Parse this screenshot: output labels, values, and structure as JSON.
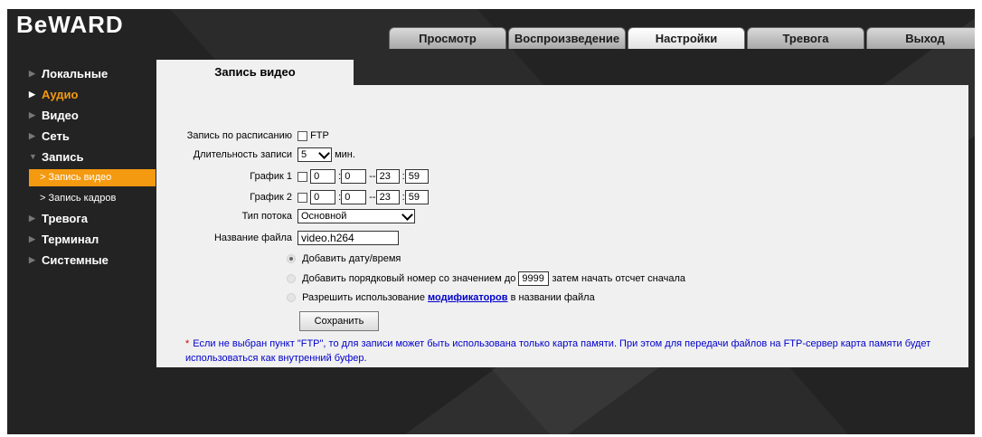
{
  "logo": "BeWARD",
  "tabs": [
    "Просмотр",
    "Воспроизведение",
    "Настройки",
    "Тревога",
    "Выход"
  ],
  "active_tab": "Настройки",
  "sidebar": {
    "items": [
      {
        "label": "Локальные"
      },
      {
        "label": "Аудио"
      },
      {
        "label": "Видео"
      },
      {
        "label": "Сеть"
      },
      {
        "label": "Запись"
      },
      {
        "label": "Тревога"
      },
      {
        "label": "Терминал"
      },
      {
        "label": "Системные"
      }
    ],
    "sub_items": [
      {
        "label": "Запись видео"
      },
      {
        "label": "Запись кадров"
      }
    ]
  },
  "panel": {
    "title": "Запись видео",
    "schedule_label": "Запись по расписанию",
    "ftp_label": "FTP",
    "duration_label": "Длительность записи",
    "duration_value": "5",
    "duration_unit": "мин.",
    "schedule1_label": "График 1",
    "schedule2_label": "График 2",
    "schedule1": {
      "h1": "0",
      "m1": "0",
      "h2": "23",
      "m2": "59"
    },
    "schedule2": {
      "h1": "0",
      "m1": "0",
      "h2": "23",
      "m2": "59"
    },
    "stream_label": "Тип потока",
    "stream_value": "Основной",
    "filename_label": "Название файла",
    "filename_value": "video.h264",
    "opt1": "Добавить дату/время",
    "opt2_pre": "Добавить порядковый номер со значением до",
    "opt2_value": "9999",
    "opt2_post": "затем начать отсчет сначала",
    "opt3_pre": "Разрешить использование",
    "opt3_link": "модификаторов",
    "opt3_post": "в названии файла",
    "save_button": "Сохранить",
    "note_star": "*",
    "note": "Если не выбран пункт \"FTP\", то для записи может быть использована только карта памяти. При этом для передачи файлов на FTP-сервер карта памяти будет использоваться как внутренний буфер."
  },
  "colors": {
    "background": "#232323",
    "accent": "#f39a10",
    "panel": "#f0f0f0",
    "link": "#0000cc"
  }
}
